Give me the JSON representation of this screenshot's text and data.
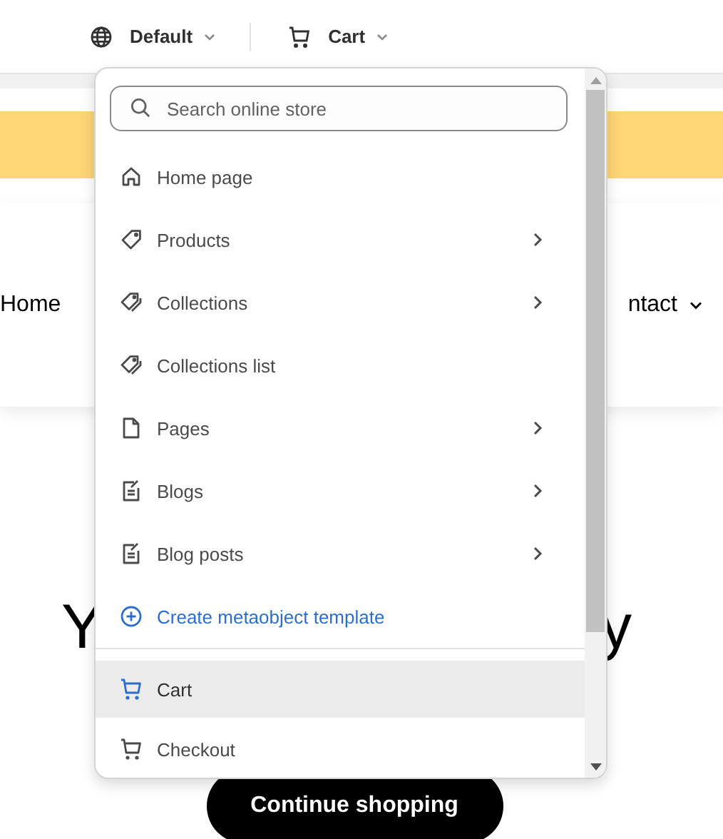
{
  "top_bar": {
    "language": {
      "label": "Default"
    },
    "template": {
      "label": "Cart"
    }
  },
  "page": {
    "nav_left": "Home",
    "nav_right": "ntact",
    "heading_left": "Y",
    "heading_right": "y",
    "button": "Continue shopping"
  },
  "dropdown": {
    "search": {
      "placeholder": "Search online store"
    },
    "groups": [
      [
        {
          "label": "Home page",
          "kind": "home",
          "submenu": false,
          "selected": false
        },
        {
          "label": "Products",
          "kind": "tag",
          "submenu": true,
          "selected": false
        },
        {
          "label": "Collections",
          "kind": "tags",
          "submenu": true,
          "selected": false
        },
        {
          "label": "Collections list",
          "kind": "tags",
          "submenu": false,
          "selected": false
        },
        {
          "label": "Pages",
          "kind": "page",
          "submenu": true,
          "selected": false
        },
        {
          "label": "Blogs",
          "kind": "blog",
          "submenu": true,
          "selected": false
        },
        {
          "label": "Blog posts",
          "kind": "blog",
          "submenu": true,
          "selected": false
        },
        {
          "label": "Create metaobject template",
          "kind": "create",
          "submenu": false,
          "selected": false
        }
      ],
      [
        {
          "label": "Cart",
          "kind": "cart",
          "submenu": false,
          "selected": true
        },
        {
          "label": "Checkout",
          "kind": "cart",
          "submenu": false,
          "selected": false
        }
      ]
    ]
  }
}
